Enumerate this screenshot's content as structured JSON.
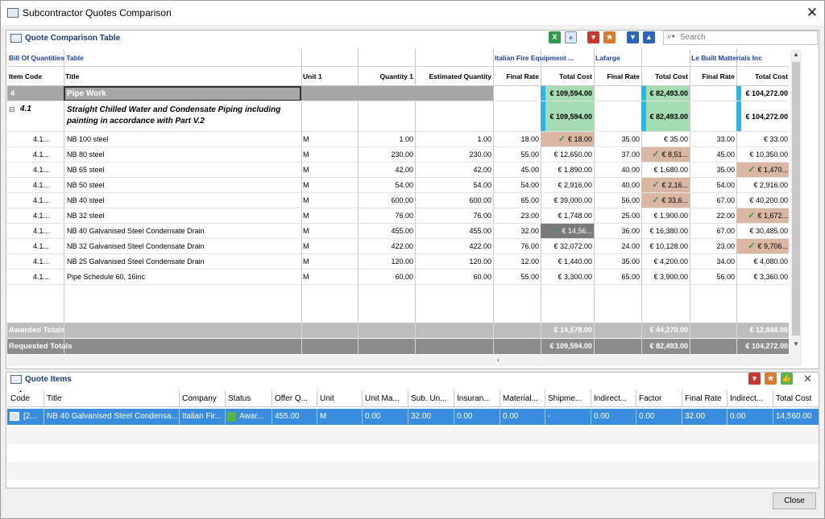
{
  "window": {
    "title": "Subcontractor Quotes Comparison"
  },
  "comparison": {
    "title": "Quote Comparison Table",
    "search_placeholder": "Search",
    "group_boq": "Bill Of Quantities Table",
    "companies": [
      "Italian Fire Equipment ...",
      "Lafarge",
      "Le Built Matterials Inc"
    ],
    "columns": {
      "item_code": "Item Code",
      "title": "Title",
      "unit": "Unit 1",
      "qty": "Quantity 1",
      "est": "Estimated Quantity",
      "final_rate": "Final Rate",
      "total_cost": "Total Cost"
    },
    "rows": [
      {
        "code": "4",
        "title": "Pipe Work",
        "unit": "",
        "qty": "",
        "est": "",
        "r1": "",
        "t1": "€ 109,594.00",
        "r2": "",
        "t2": "€ 82,493.00",
        "r3": "",
        "t3": "€ 104,272.00",
        "level": 0
      },
      {
        "code": "4.1",
        "title": "Straight Chilled Water and Condensate Piping including painting in accordance with Part V.2",
        "unit": "",
        "qty": "",
        "est": "",
        "r1": "",
        "t1": "€ 109,594.00",
        "r2": "",
        "t2": "€ 82,493.00",
        "r3": "",
        "t3": "€ 104,272.00",
        "level": 1
      },
      {
        "code": "4.1...",
        "title": "NB 100 steel",
        "unit": "M",
        "qty": "1.00",
        "est": "1.00",
        "r1": "18.00",
        "t1": "€ 18.00",
        "r2": "35.00",
        "t2": "€ 35.00",
        "r3": "33.00",
        "t3": "€ 33.00",
        "best": 1,
        "level": 2
      },
      {
        "code": "4.1...",
        "title": "NB 80 steel",
        "unit": "M",
        "qty": "230.00",
        "est": "230.00",
        "r1": "55.00",
        "t1": "€ 12,650.00",
        "r2": "37.00",
        "t2": "€ 8,51...",
        "r3": "45.00",
        "t3": "€ 10,350.00",
        "best": 2,
        "level": 2
      },
      {
        "code": "4.1...",
        "title": "NB 65 steel",
        "unit": "M",
        "qty": "42.00",
        "est": "42.00",
        "r1": "45.00",
        "t1": "€ 1,890.00",
        "r2": "40.00",
        "t2": "€ 1,680.00",
        "r3": "35.00",
        "t3": "€ 1,470...",
        "best": 3,
        "level": 2
      },
      {
        "code": "4.1...",
        "title": "NB 50 steel",
        "unit": "M",
        "qty": "54.00",
        "est": "54.00",
        "r1": "54.00",
        "t1": "€ 2,916.00",
        "r2": "40.00",
        "t2": "€ 2,16...",
        "r3": "54.00",
        "t3": "€ 2,916.00",
        "best": 2,
        "level": 2
      },
      {
        "code": "4.1...",
        "title": "NB 40 steel",
        "unit": "M",
        "qty": "600.00",
        "est": "600.00",
        "r1": "65.00",
        "t1": "€ 39,000.00",
        "r2": "56.00",
        "t2": "€ 33,6...",
        "r3": "67.00",
        "t3": "€ 40,200.00",
        "best": 2,
        "level": 2
      },
      {
        "code": "4.1...",
        "title": "NB 32 steel",
        "unit": "M",
        "qty": "76.00",
        "est": "76.00",
        "r1": "23.00",
        "t1": "€ 1,748.00",
        "r2": "25.00",
        "t2": "€ 1,900.00",
        "r3": "22.00",
        "t3": "€ 1,672...",
        "best": 3,
        "level": 2
      },
      {
        "code": "4.1...",
        "title": "NB 40 Galvanised Steel Condensate Drain",
        "unit": "M",
        "qty": "455.00",
        "est": "455.00",
        "r1": "32.00",
        "t1": "€ 14,56...",
        "r2": "36.00",
        "t2": "€ 16,380.00",
        "r3": "67.00",
        "t3": "€ 30,485.00",
        "best": 1,
        "sel": true,
        "level": 2
      },
      {
        "code": "4.1...",
        "title": "NB 32 Galvanised Steel Condensate Drain",
        "unit": "M",
        "qty": "422.00",
        "est": "422.00",
        "r1": "76.00",
        "t1": "€ 32,072.00",
        "r2": "24.00",
        "t2": "€ 10,128.00",
        "r3": "23.00",
        "t3": "€ 9,706...",
        "best": 3,
        "level": 2
      },
      {
        "code": "4.1...",
        "title": "NB 25 Galvanised Steel Condensate Drain",
        "unit": "M",
        "qty": "120.00",
        "est": "120.00",
        "r1": "12.00",
        "t1": "€ 1,440.00",
        "r2": "35.00",
        "t2": "€ 4,200.00",
        "r3": "34.00",
        "t3": "€ 4,080.00",
        "best": 0,
        "level": 2
      },
      {
        "code": "4.1...",
        "title": "Pipe Schedule 60, 16inc",
        "unit": "M",
        "qty": "60.00",
        "est": "60.00",
        "r1": "55.00",
        "t1": "€ 3,300.00",
        "r2": "65.00",
        "t2": "€ 3,900.00",
        "r3": "56.00",
        "t3": "€ 3,360.00",
        "best": 0,
        "level": 2
      }
    ],
    "totals": [
      {
        "label": "Awarded Totals",
        "t1": "€ 14,578.00",
        "t2": "€ 44,270.00",
        "t3": "€ 12,848.00"
      },
      {
        "label": "Requested Totals",
        "t1": "€ 109,594.00",
        "t2": "€ 82,493.00",
        "t3": "€ 104,272.00"
      }
    ]
  },
  "quote_items": {
    "title": "Quote Items",
    "sort_indicator": "1",
    "columns": [
      "Code",
      "Title",
      "Company",
      "Status",
      "Offer Q...",
      "Unit",
      "Unit Ma...",
      "Sub. Un...",
      "Insuran...",
      "Material...",
      "Shipme...",
      "Indirect...",
      "Factor",
      "Final Rate",
      "Indirect...",
      "Total Cost"
    ],
    "row": [
      "[2...",
      "NB 40 Galvanised Steel Condensa...",
      "Italian Fir...",
      "Awar...",
      "455.00",
      "M",
      "0.00",
      "32.00",
      "0.00",
      "0.00",
      "-",
      "0.00",
      "0.00",
      "32.00",
      "0.00",
      "14,560.00"
    ]
  },
  "footer": {
    "close_label": "Close"
  },
  "colors": {
    "accent_blue": "#2d66b9",
    "best_bg": "#d9b7a3",
    "select_bg": "#3a8dde",
    "header_title": "#1a3a7a"
  }
}
